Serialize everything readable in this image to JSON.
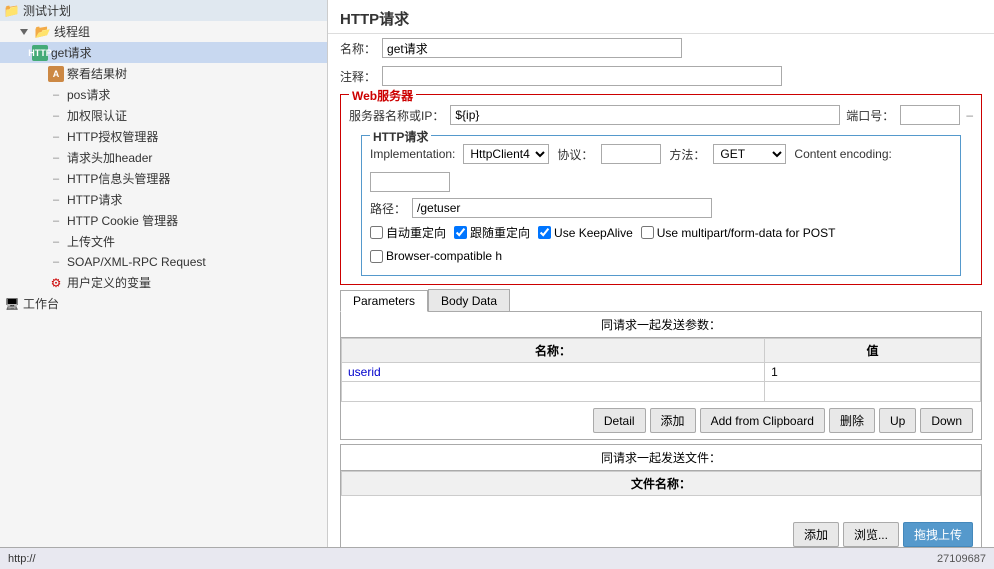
{
  "app": {
    "title": "HTTP请求",
    "left_panel_title": "测试计划"
  },
  "tree": {
    "items": [
      {
        "id": "test-plan",
        "label": "测试计划",
        "indent": 0,
        "icon": "folder",
        "expanded": true
      },
      {
        "id": "thread-group",
        "label": "线程组",
        "indent": 1,
        "icon": "folder-open",
        "expanded": true
      },
      {
        "id": "get-request",
        "label": "get请求",
        "indent": 2,
        "icon": "http",
        "selected": true
      },
      {
        "id": "assert-result",
        "label": "察看结果树",
        "indent": 3,
        "icon": "assert"
      },
      {
        "id": "pos-request",
        "label": "pos请求",
        "indent": 3,
        "icon": "gray"
      },
      {
        "id": "auth",
        "label": "加权限认证",
        "indent": 3,
        "icon": "gray"
      },
      {
        "id": "http-manager",
        "label": "HTTP授权管理器",
        "indent": 3,
        "icon": "gray"
      },
      {
        "id": "header",
        "label": "请求头加header",
        "indent": 3,
        "icon": "gray"
      },
      {
        "id": "http-info-manager",
        "label": "HTTP信息头管理器",
        "indent": 3,
        "icon": "gray"
      },
      {
        "id": "http-request",
        "label": "HTTP请求",
        "indent": 3,
        "icon": "gray"
      },
      {
        "id": "cookie-manager",
        "label": "HTTP Cookie 管理器",
        "indent": 3,
        "icon": "gray"
      },
      {
        "id": "upload-file",
        "label": "上传文件",
        "indent": 3,
        "icon": "gray"
      },
      {
        "id": "soap-rpc",
        "label": "SOAP/XML-RPC Request",
        "indent": 3,
        "icon": "gray"
      },
      {
        "id": "user-vars",
        "label": "用户定义的变量",
        "indent": 3,
        "icon": "user-var"
      },
      {
        "id": "workbench",
        "label": "工作台",
        "indent": 0,
        "icon": "workbench"
      }
    ]
  },
  "form": {
    "panel_title": "HTTP请求",
    "name_label": "名称：",
    "name_value": "get请求",
    "comment_label": "注释：",
    "comment_value": "",
    "web_server_label": "Web服务器",
    "server_name_label": "服务器名称或IP：",
    "server_value": "${ip}",
    "port_label": "端口号：",
    "port_value": "",
    "http_section_label": "HTTP请求",
    "impl_label": "Implementation:",
    "impl_value": "HttpClient4",
    "protocol_label": "协议：",
    "protocol_value": "",
    "method_label": "方法：",
    "method_value": "GET",
    "content_encoding_label": "Content encoding:",
    "content_encoding_value": "",
    "path_label": "路径：",
    "path_value": "/getuser",
    "auto_redirect_label": "自动重定向",
    "auto_redirect_checked": false,
    "follow_redirect_label": "跟随重定向",
    "follow_redirect_checked": true,
    "keep_alive_label": "Use KeepAlive",
    "keep_alive_checked": true,
    "multipart_label": "Use multipart/form-data for POST",
    "multipart_checked": false,
    "browser_compat_label": "Browser-compatible h",
    "browser_compat_checked": false,
    "tabs": [
      {
        "id": "parameters",
        "label": "Parameters",
        "active": true
      },
      {
        "id": "body-data",
        "label": "Body Data",
        "active": false
      }
    ],
    "params_section_title": "同请求一起发送参数：",
    "params_col_name": "名称：",
    "params_col_value": "值",
    "params_rows": [
      {
        "name": "userid",
        "value": "1"
      }
    ],
    "params_buttons": {
      "detail": "Detail",
      "add": "添加",
      "add_from_clipboard": "Add from Clipboard",
      "delete": "删除",
      "up": "Up",
      "down": "Down"
    },
    "files_section_title": "同请求一起发送文件：",
    "files_col_name": "文件名称：",
    "files_buttons": {
      "add": "添加",
      "browse": "浏览...",
      "upload": "拖拽上传"
    }
  },
  "status_bar": {
    "url": "http://",
    "count": "27109687"
  }
}
